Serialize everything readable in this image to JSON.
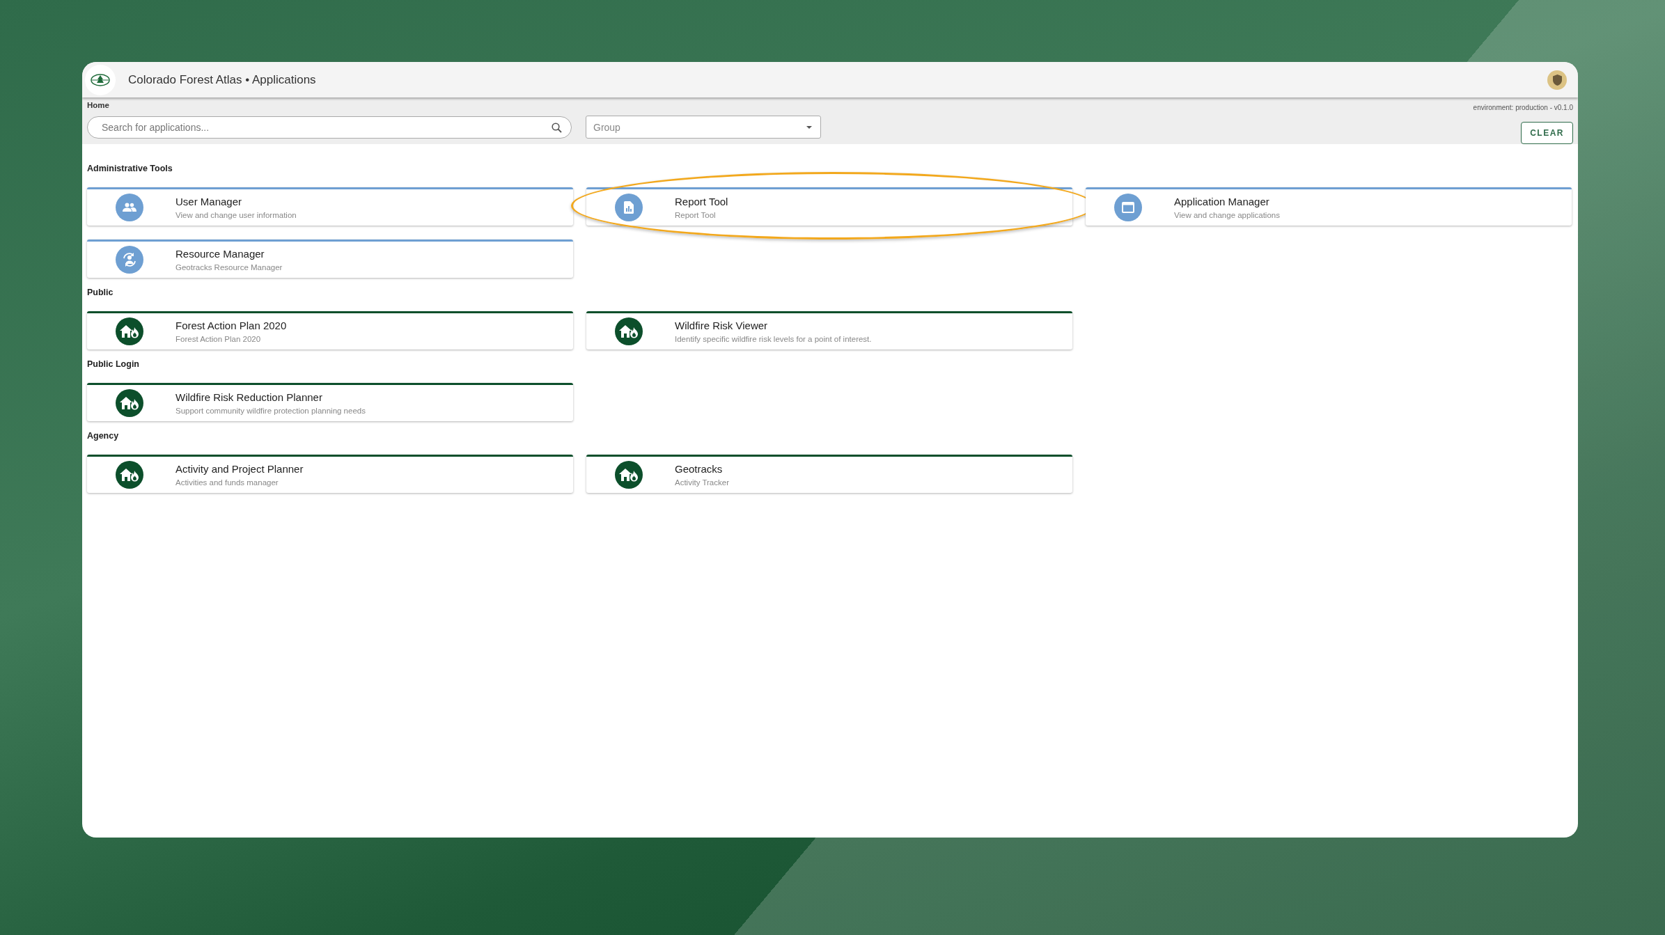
{
  "header": {
    "title": "Colorado Forest Atlas • Applications"
  },
  "breadcrumb": "Home",
  "environment": "environment: production - v0.1.0",
  "search": {
    "placeholder": "Search for applications..."
  },
  "group_select": {
    "placeholder": "Group"
  },
  "clear_button": "CLEAR",
  "sections": [
    {
      "title": "Administrative Tools",
      "color": "#6e9fd2",
      "apps": [
        {
          "name": "User Manager",
          "description": "View and change user information",
          "kind": "users",
          "highlighted": false
        },
        {
          "name": "Report Tool",
          "description": "Report Tool",
          "kind": "report",
          "highlighted": true
        },
        {
          "name": "Application Manager",
          "description": "View and change applications",
          "kind": "window",
          "highlighted": false
        },
        {
          "name": "Resource Manager",
          "description": "Geotracks Resource Manager",
          "kind": "resource",
          "highlighted": false
        }
      ]
    },
    {
      "title": "Public",
      "color": "#0c4f2b",
      "apps": [
        {
          "name": "Forest Action Plan 2020",
          "description": "Forest Action Plan 2020",
          "kind": "house-fire",
          "highlighted": false
        },
        {
          "name": "Wildfire Risk Viewer",
          "description": "Identify specific wildfire risk levels for a point of interest.",
          "kind": "house-fire",
          "highlighted": false
        }
      ]
    },
    {
      "title": "Public Login",
      "color": "#0c4f2b",
      "apps": [
        {
          "name": "Wildfire Risk Reduction Planner",
          "description": "Support community wildfire protection planning needs",
          "kind": "house-fire",
          "highlighted": false
        }
      ]
    },
    {
      "title": "Agency",
      "color": "#0c4f2b",
      "apps": [
        {
          "name": "Activity and Project Planner",
          "description": "Activities and funds manager",
          "kind": "house-fire",
          "highlighted": false
        },
        {
          "name": "Geotracks",
          "description": "Activity Tracker",
          "kind": "house-fire",
          "highlighted": false
        }
      ]
    }
  ]
}
